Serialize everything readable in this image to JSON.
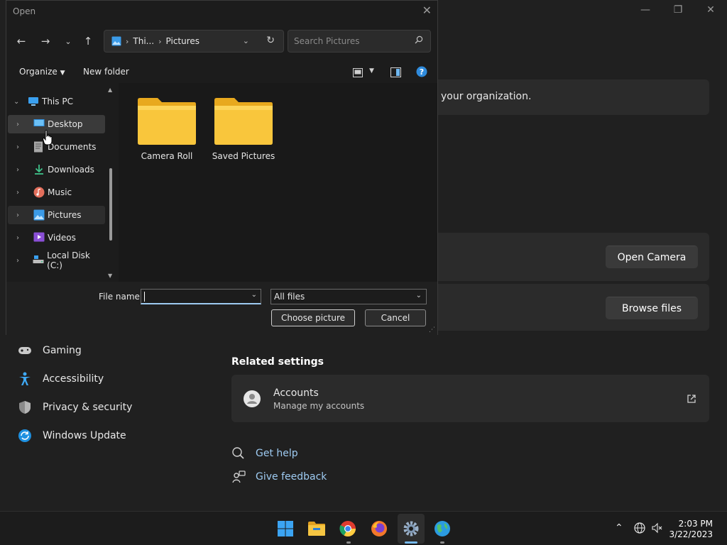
{
  "settings": {
    "org_text": "your organization.",
    "open_camera": "Open Camera",
    "browse_files": "Browse files",
    "nav": [
      {
        "label": "Gaming"
      },
      {
        "label": "Accessibility"
      },
      {
        "label": "Privacy & security"
      },
      {
        "label": "Windows Update"
      }
    ],
    "related_title": "Related settings",
    "accounts_title": "Accounts",
    "accounts_sub": "Manage my accounts",
    "get_help": "Get help",
    "give_feedback": "Give feedback",
    "accent": "#9ecbf2"
  },
  "dialog": {
    "title": "Open",
    "address": {
      "root": "Thi...",
      "current": "Pictures"
    },
    "search_placeholder": "Search Pictures",
    "organize": "Organize",
    "new_folder": "New folder",
    "tree": {
      "root": "This PC",
      "items": [
        {
          "label": "Desktop"
        },
        {
          "label": "Documents"
        },
        {
          "label": "Downloads"
        },
        {
          "label": "Music"
        },
        {
          "label": "Pictures"
        },
        {
          "label": "Videos"
        },
        {
          "label": "Local Disk (C:)"
        }
      ]
    },
    "folders": [
      {
        "label": "Camera Roll"
      },
      {
        "label": "Saved Pictures"
      }
    ],
    "file_name_label": "File name:",
    "file_name_value": "",
    "filter": "All files",
    "choose": "Choose picture",
    "cancel": "Cancel"
  },
  "taskbar": {
    "time": "2:03 PM",
    "date": "3/22/2023"
  }
}
